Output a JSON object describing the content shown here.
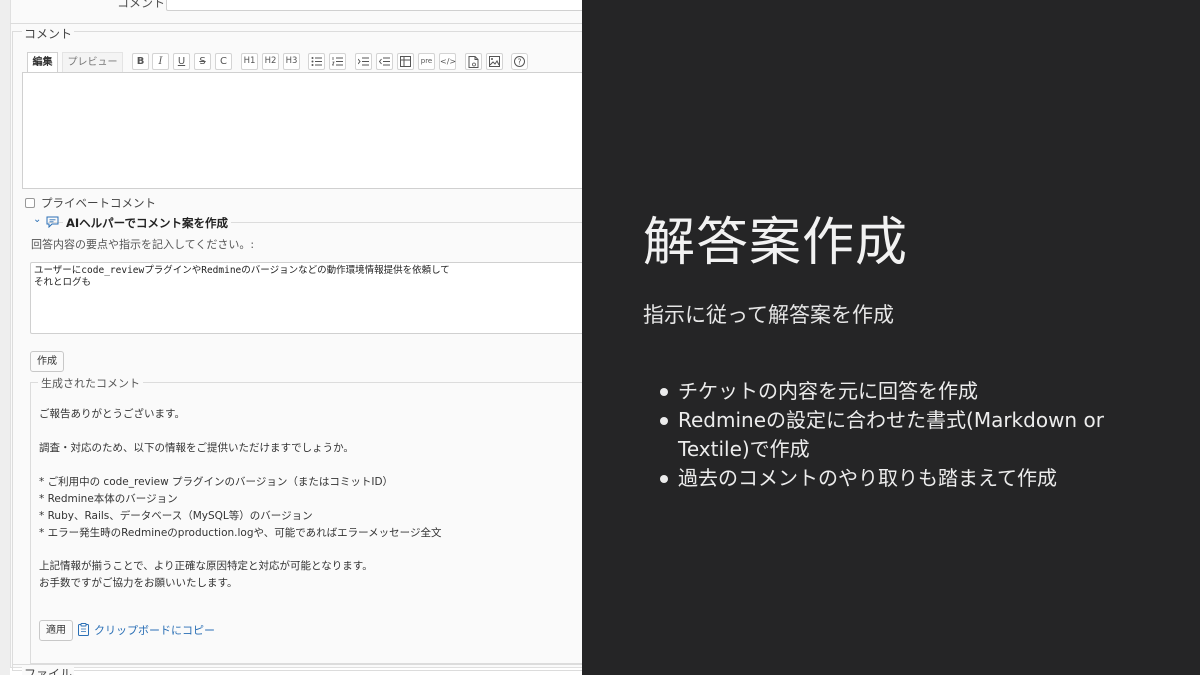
{
  "form": {
    "comment_field_label": "コメント",
    "comment_legend": "コメント",
    "tabs": {
      "edit": "編集",
      "preview": "プレビュー"
    },
    "toolbar": [
      {
        "name": "bold-button",
        "label": "B"
      },
      {
        "name": "italic-button",
        "label": "I"
      },
      {
        "name": "underline-button",
        "label": "U"
      },
      {
        "name": "strikethrough-button",
        "label": "S"
      },
      {
        "name": "code-inline-button",
        "label": "C"
      },
      {
        "name": "heading1-button",
        "label": "H1"
      },
      {
        "name": "heading2-button",
        "label": "H2"
      },
      {
        "name": "heading3-button",
        "label": "H3"
      },
      {
        "name": "bullet-list-button",
        "icon": "bullet-list-icon"
      },
      {
        "name": "numbered-list-button",
        "icon": "numbered-list-icon"
      },
      {
        "name": "indent-button",
        "icon": "indent-icon"
      },
      {
        "name": "outdent-button",
        "icon": "outdent-icon"
      },
      {
        "name": "table-button",
        "icon": "table-icon"
      },
      {
        "name": "pre-button",
        "label": "pre"
      },
      {
        "name": "code-block-button",
        "label": "</>"
      },
      {
        "name": "link-button",
        "icon": "document-link-icon"
      },
      {
        "name": "image-button",
        "icon": "image-icon"
      },
      {
        "name": "help-button",
        "icon": "help-icon"
      }
    ],
    "private_comment_label": "プライベートコメント",
    "ai_helper": {
      "title": "AIヘルパーでコメント案を作成",
      "prompt_label": "回答内容の要点や指示を記入してください。:",
      "prompt_value": "ユーザーにcode_reviewプラグインやRedmineのバージョンなどの動作環境情報提供を依頼して\nそれとログも",
      "create_button": "作成",
      "generated_legend": "生成されたコメント",
      "generated_lines": [
        "ご報告ありがとうございます。",
        "調査・対応のため、以下の情報をご提供いただけますでしょうか。",
        "* ご利用中の code_review プラグインのバージョン（またはコミットID）",
        "* Redmine本体のバージョン",
        "* Ruby、Rails、データベース（MySQL等）のバージョン",
        "* エラー発生時のRedmineのproduction.logや、可能であればエラーメッセージ全文",
        "上記情報が揃うことで、より正確な原因特定と対応が可能となります。",
        "お手数ですがご協力をお願いいたします。"
      ],
      "apply_button": "適用",
      "copy_link": "クリップボードにコピー"
    },
    "files_legend": "ファイル"
  },
  "slide": {
    "title": "解答案作成",
    "subtitle": "指示に従って解答案を作成",
    "bullets": [
      "チケットの内容を元に回答を作成",
      "Redmineの設定に合わせた書式(Markdown or Textile)で作成",
      "過去のコメントのやり取りも踏まえて作成"
    ]
  },
  "colors": {
    "link": "#2a6fb5",
    "slide_bg": "#252526",
    "slide_text": "#f2f2f2"
  }
}
